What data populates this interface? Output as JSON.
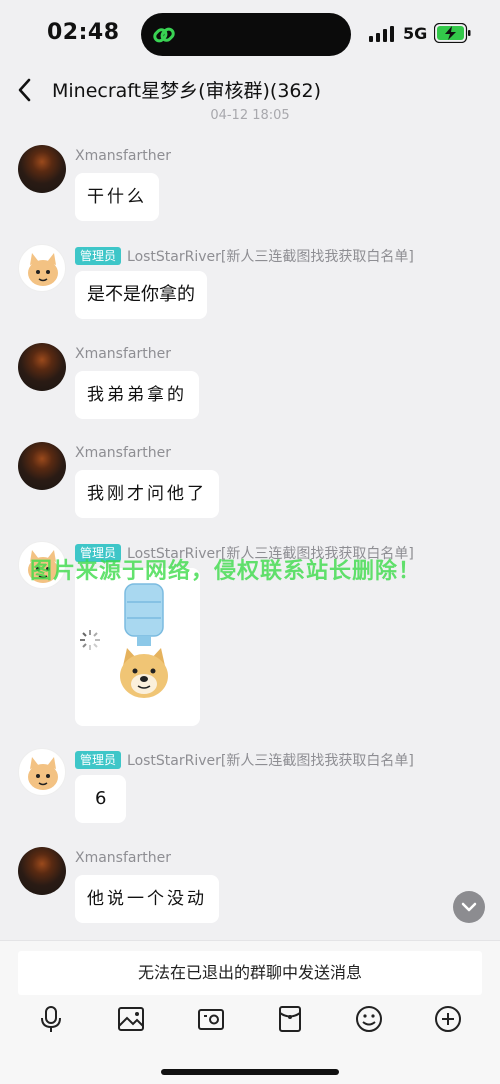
{
  "status": {
    "time": "02:48",
    "network": "5G"
  },
  "nav": {
    "title": "Minecraft星梦乡(审核群)(362)"
  },
  "date_divider": "04-12 18:05",
  "messages": [
    {
      "sender": "Xmansfarther",
      "text": "干什么"
    },
    {
      "badge": "管理员",
      "sender": "LostStarRiver[新人三连截图找我获取白名单]",
      "text": "是不是你拿的"
    },
    {
      "sender": "Xmansfarther",
      "text": "我弟弟拿的"
    },
    {
      "sender": "Xmansfarther",
      "text": "我刚才问他了"
    },
    {
      "badge": "管理员",
      "sender": "LostStarRiver[新人三连截图找我获取白名单]",
      "text": ""
    },
    {
      "badge": "管理员",
      "sender": "LostStarRiver[新人三连截图找我获取白名单]",
      "text": "6"
    },
    {
      "sender": "Xmansfarther",
      "text": "他说一个没动"
    }
  ],
  "watermark": "图片来源于网络，侵权联系站长删除！",
  "bottom": {
    "notice": "无法在已退出的群聊中发送消息"
  }
}
